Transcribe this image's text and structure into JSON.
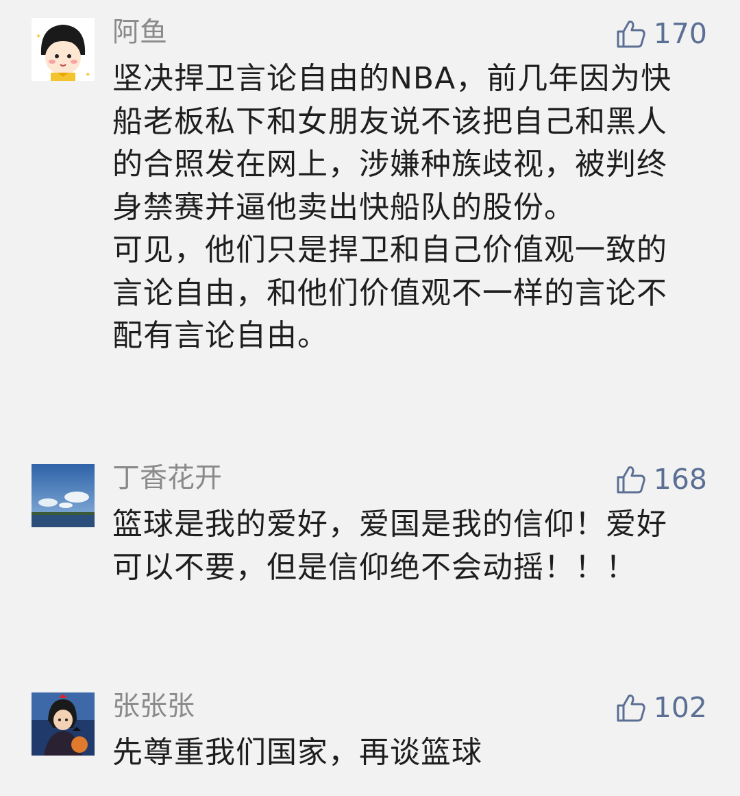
{
  "comments": [
    {
      "username": "阿鱼",
      "likes": "170",
      "avatar_icon": "cartoon-girl-avatar",
      "paragraphs": [
        "坚决捍卫言论自由的NBA，前几年因为快船老板私下和女朋友说不该把自己和黑人的合照发在网上，涉嫌种族歧视，被判终身禁赛并逼他卖出快船队的股份。",
        "可见，他们只是捍卫和自己价值观一致的言论自由，和他们价值观不一样的言论不配有言论自由。"
      ]
    },
    {
      "username": "丁香花开",
      "likes": "168",
      "avatar_icon": "sky-lake-avatar",
      "paragraphs": [
        "篮球是我的爱好，爱国是我的信仰！爱好可以不要，但是信仰绝不会动摇！！！"
      ]
    },
    {
      "username": "张张张",
      "likes": "102",
      "avatar_icon": "witch-girl-avatar",
      "paragraphs": [
        "先尊重我们国家，再谈篮球"
      ]
    }
  ],
  "like_icon": "thumbs-up-icon",
  "colors": {
    "background": "#f2f2f2",
    "username": "#8a8a8a",
    "like": "#5b6f94",
    "text": "#1e1e1e"
  }
}
